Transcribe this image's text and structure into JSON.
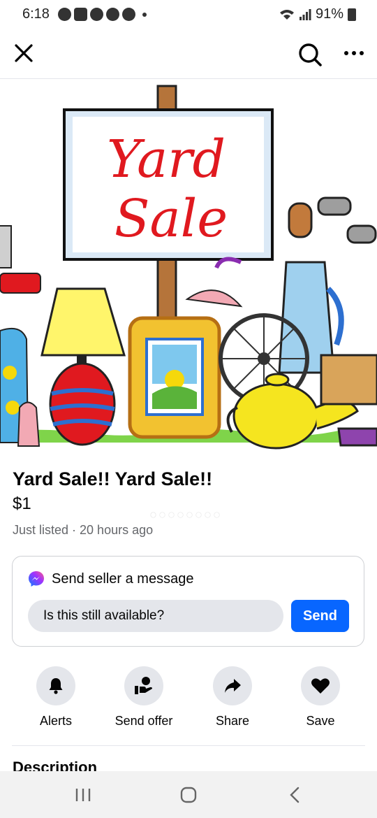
{
  "status_bar": {
    "time": "6:18",
    "battery": "91%"
  },
  "listing": {
    "title": "Yard Sale!! Yard Sale!!",
    "price": "$1",
    "listed": "Just listed · 20 hours ago",
    "image": {
      "sign_text_line1": "Yard",
      "sign_text_line2": "Sale",
      "carousel_count": 8,
      "carousel_active": 1
    }
  },
  "message": {
    "header": "Send seller a message",
    "input_value": "Is this still available?",
    "send_label": "Send"
  },
  "actions": [
    {
      "label": "Alerts",
      "icon": "bell-icon"
    },
    {
      "label": "Send offer",
      "icon": "offer-icon"
    },
    {
      "label": "Share",
      "icon": "share-icon"
    },
    {
      "label": "Save",
      "icon": "heart-icon"
    }
  ],
  "description_heading": "Description",
  "colors": {
    "accent": "#0866ff",
    "muted_text": "#65676b",
    "chip_bg": "#e4e6eb"
  }
}
